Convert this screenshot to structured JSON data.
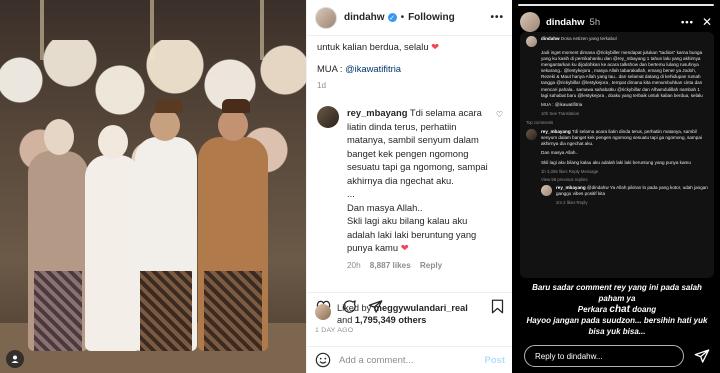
{
  "post": {
    "username": "dindahw",
    "follow_label": "Following",
    "more_label": "•••",
    "caption_tail": "untuk kalian berdua, selalu",
    "mua_label": "MUA :",
    "mua_handle": "@ikawatifitria",
    "caption_time": "1d",
    "comment": {
      "username": "rey_mbayang",
      "text1": "Tdi selama acara liatin dinda terus, perhatiin matanya, sambil senyum dalam banget kek pengen ngomong sesuatu tapi ga ngomong, sampai akhirnya dia ngechat aku.",
      "ellipsis": "...",
      "text2": "Dan masya Allah..",
      "text3": "Skli lagi aku bilang kalau aku adalah laki laki beruntung yang punya kamu",
      "time": "20h",
      "likes": "8,887 likes",
      "reply_label": "Reply"
    },
    "liked_by_prefix": "Liked by",
    "liked_by_user": "meggywulandari_real",
    "liked_by_and": "and",
    "liked_by_others": "1,795,349 others",
    "timestamp": "1 DAY AGO",
    "add_comment_placeholder": "Add a comment...",
    "post_button": "Post"
  },
  "story": {
    "username": "dindahw",
    "time": "5h",
    "dots": "•••",
    "close": "✕",
    "shot": {
      "caption_user": "dindahw",
      "caption_head": "Dosa netizen yang terkabul",
      "caption_body": "Jadi inget moment dimana @rickybiller mendapat julukan \"tadiios\" karna bunga yang ku kasih di pernikahanku dan @rey_mbayang 1 tahun lalu yang akhirnya mengantarkan ku dijodohkan ke acara talkshow dan bertemu lulang rusuhnya sekarang.. @lestykejora , masya Allah tabarakallah, emang bener ya Jodoh, Rezeki & Maut hanya Allah yang tau.. dan selamat datang di kehidupan rumah tangga @rickybillar @lestykejora , tempat dimana kita menumbuhkan cinta dan mencari pahala.. samawa sahabatku @rickybillar dan Alhamdulillah nambah 1 lagi sahabat baru @lestykejora , doaku yang terbaik untuk kalian berdua, selalu",
      "caption_mua": "MUA : @ikawatifitria",
      "caption_meta": "10h   See Translation",
      "top_comments": "Top comments",
      "comment_user": "rey_mbayang",
      "comment_text1": "Tdi selama acara liatin dinda terus, perhatiin matanya, sambil senyum dalam banget kek pengen ngomong sesuatu tapi ga ngomong, sampai akhirnya dia ngechat aku.",
      "comment_text2": "Dan masya Allah..",
      "comment_text3": "Skli lagi aku bilang kalau aku adalah laki laki beruntung yang punya kamu",
      "comment_meta": "1h   3,356 likes   Reply   Message",
      "view_replies": "View 58 previous replies",
      "reply_user": "rey_mbayang",
      "reply_text": "@dindahw Ya Allah pikiran lo pada yang kotor, udah jangan ganggu vibes positif kita",
      "reply_meta": "2m   2 likes   Reply"
    },
    "caption_line1": "Baru sadar comment rey yang ini pada salah paham ya",
    "caption_line2a": "Perkara",
    "caption_line2b": "chat",
    "caption_line2c": "doang",
    "caption_line3": "Hayoo jangan pada suudzon... bersihin hati yuk bisa yuk bisa...",
    "reply_placeholder": "Reply to dindahw..."
  },
  "colors": {
    "accent_blue": "#3897f0",
    "heart_red": "#ed4956",
    "mention_blue": "#00376b"
  }
}
